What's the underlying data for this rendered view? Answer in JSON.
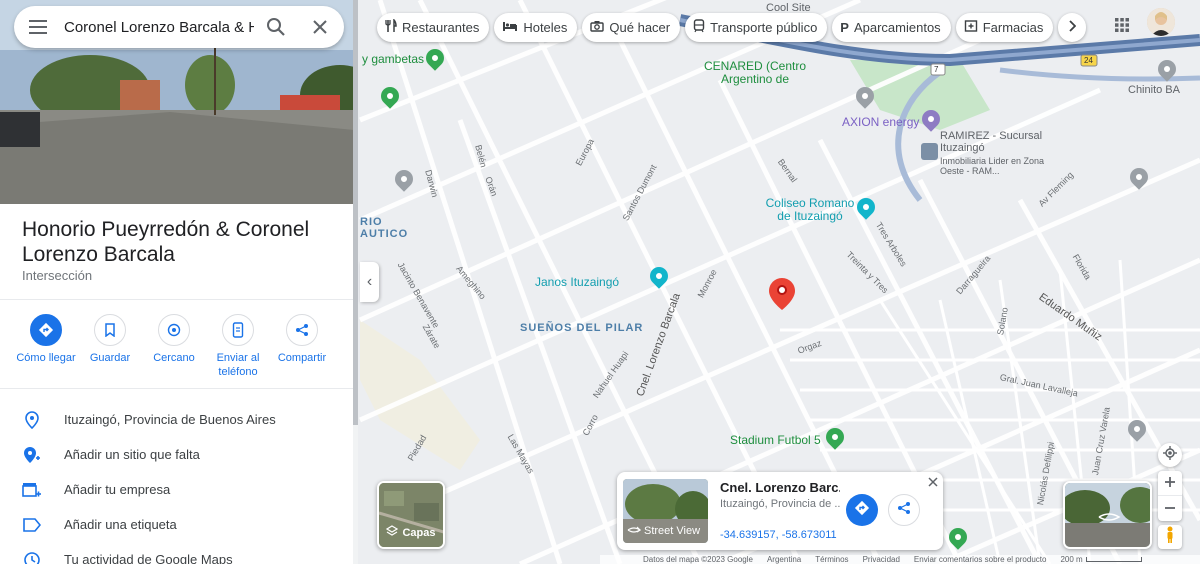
{
  "search": {
    "value": "Coronel Lorenzo Barcala & Hon"
  },
  "place": {
    "title": "Honorio Pueyrredón & Coronel Lorenzo Barcala",
    "type": "Intersección"
  },
  "actions": [
    {
      "label": "Cómo llegar",
      "icon": "directions-icon"
    },
    {
      "label": "Guardar",
      "icon": "bookmark-icon"
    },
    {
      "label": "Cercano",
      "icon": "nearby-icon"
    },
    {
      "label": "Enviar al teléfono",
      "icon": "send-to-phone-icon"
    },
    {
      "label": "Compartir",
      "icon": "share-icon"
    }
  ],
  "info_rows": [
    {
      "label": "Ituzaingó, Provincia de Buenos Aires",
      "icon": "location-pin-icon"
    },
    {
      "label": "Añadir un sitio que falta",
      "icon": "add-place-icon"
    },
    {
      "label": "Añadir tu empresa",
      "icon": "add-business-icon"
    },
    {
      "label": "Añadir una etiqueta",
      "icon": "label-icon"
    },
    {
      "label": "Tu actividad de Google Maps",
      "icon": "history-icon"
    }
  ],
  "chips": [
    {
      "label": "Restaurantes",
      "icon": "restaurant-icon"
    },
    {
      "label": "Hoteles",
      "icon": "hotel-icon"
    },
    {
      "label": "Qué hacer",
      "icon": "camera-icon"
    },
    {
      "label": "Transporte público",
      "icon": "transit-icon"
    },
    {
      "label": "Aparcamientos",
      "icon": "parking-icon"
    },
    {
      "label": "Farmacias",
      "icon": "pharmacy-icon"
    }
  ],
  "map": {
    "pois": [
      {
        "label": "Janos Ituzaingó",
        "style": "teal"
      },
      {
        "label": "Coliseo Romano de Ituzaingó",
        "style": "teal"
      },
      {
        "label": "CENARED (Centro Argentino de",
        "style": "green"
      },
      {
        "label": "Stadium Futbol 5",
        "style": "green"
      },
      {
        "label": "AXION energy",
        "style": "purple"
      },
      {
        "label": "RAMIREZ - Sucursal Ituzaingó",
        "style": "gray"
      },
      {
        "label": "Inmobiliaria Lider en Zona Oeste - RAM...",
        "style": "gray-small"
      },
      {
        "label": "Chinito BA",
        "style": "gray"
      },
      {
        "label": "Cool Site",
        "style": "gray"
      },
      {
        "label": "y gambetas",
        "style": "green"
      }
    ],
    "area_labels": [
      "SUEÑOS DEL PILAR",
      "RIO AUTICO"
    ],
    "streets": [
      "Cnel. Lorenzo Barcala",
      "Eduardo Muñiz",
      "Gral. Juan Lavalleja",
      "Santos Dumont",
      "Ameghino",
      "Jacinto Benavente",
      "Tres Arboles",
      "Treinta y Tres",
      "Darragueira",
      "Europa",
      "Monroe",
      "Orgaz",
      "Nahuel Huapi",
      "Corro",
      "Las Mayas",
      "Piedad",
      "Zárate",
      "Av Fleming",
      "Solano",
      "Bernal",
      "Florida",
      "Darwin",
      "Belén",
      "Orán",
      "Juan Cruz Varela",
      "Nicolás Defilippi"
    ],
    "route_badges": [
      "7",
      "24"
    ]
  },
  "collapse_label": "‹",
  "layers": {
    "label": "Capas"
  },
  "card": {
    "title": "Cnel. Lorenzo Barc...",
    "subtitle": "Ituzaingó, Provincia de ...",
    "coords": "-34.639157, -58.673011",
    "street_view": "Street View"
  },
  "footer": {
    "items": [
      "Datos del mapa ©2023 Google",
      "Argentina",
      "Términos",
      "Privacidad",
      "Enviar comentarios sobre el producto"
    ],
    "scale": "200 m"
  },
  "colors": {
    "accent": "#1a73e8",
    "pin": "#ea4335",
    "highway": "#5b7aa8",
    "green_area": "#c8e6c9"
  }
}
